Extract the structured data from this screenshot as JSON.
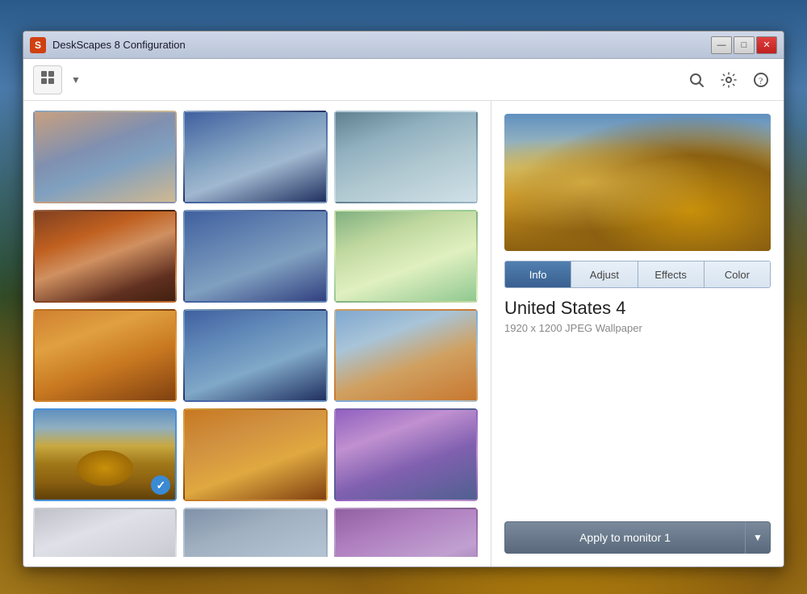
{
  "window": {
    "title": "DeskScapes 8 Configuration",
    "icon_label": "S"
  },
  "toolbar": {
    "layout_icon": "⊞",
    "search_icon": "🔍",
    "settings_icon": "⚙",
    "help_icon": "?"
  },
  "tabs": [
    {
      "id": "info",
      "label": "Info",
      "active": true
    },
    {
      "id": "adjust",
      "label": "Adjust",
      "active": false
    },
    {
      "id": "effects",
      "label": "Effects",
      "active": false
    },
    {
      "id": "color",
      "label": "Color",
      "active": false
    }
  ],
  "selected_wallpaper": {
    "title": "United States 4",
    "meta": "1920 x 1200 JPEG Wallpaper"
  },
  "apply_button": {
    "label": "Apply to monitor 1"
  },
  "title_bar_controls": {
    "minimize": "—",
    "maximize": "□",
    "close": "✕"
  },
  "thumbnails": [
    {
      "id": 1,
      "cls": "thumb-1",
      "selected": false
    },
    {
      "id": 2,
      "cls": "thumb-2",
      "selected": false
    },
    {
      "id": 3,
      "cls": "thumb-3",
      "selected": false
    },
    {
      "id": 4,
      "cls": "thumb-4",
      "selected": false
    },
    {
      "id": 5,
      "cls": "thumb-5",
      "selected": false
    },
    {
      "id": 6,
      "cls": "thumb-6",
      "selected": false
    },
    {
      "id": 7,
      "cls": "thumb-7",
      "selected": false
    },
    {
      "id": 8,
      "cls": "thumb-8",
      "selected": false
    },
    {
      "id": 9,
      "cls": "thumb-9",
      "selected": false
    },
    {
      "id": 10,
      "cls": "thumb-haybale thumb-10",
      "selected": true
    },
    {
      "id": 11,
      "cls": "thumb-11",
      "selected": false
    },
    {
      "id": 12,
      "cls": "thumb-12",
      "selected": false
    },
    {
      "id": 13,
      "cls": "thumb-13",
      "selected": false
    },
    {
      "id": 14,
      "cls": "thumb-14",
      "selected": false
    },
    {
      "id": 15,
      "cls": "thumb-15",
      "selected": false
    }
  ]
}
